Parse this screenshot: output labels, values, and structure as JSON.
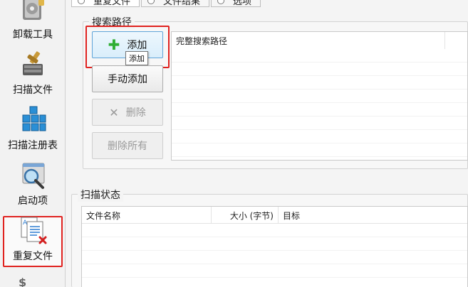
{
  "sidebar": {
    "items": [
      {
        "label": "卸载工具",
        "icon": "uninstall-icon"
      },
      {
        "label": "扫描文件",
        "icon": "scan-files-icon"
      },
      {
        "label": "扫描注册表",
        "icon": "registry-icon"
      },
      {
        "label": "启动项",
        "icon": "startup-icon"
      },
      {
        "label": "重复文件",
        "icon": "duplicate-files-icon",
        "active": true
      }
    ]
  },
  "tabs": [
    {
      "label": "重复文件",
      "active": true
    },
    {
      "label": "文件结果",
      "active": false
    },
    {
      "label": "选项",
      "active": false
    }
  ],
  "search_path": {
    "title": "搜索路径",
    "buttons": {
      "add": "添加",
      "manual_add": "手动添加",
      "delete": "删除",
      "delete_all": "删除所有"
    },
    "tooltip": "添加",
    "list_header": "完整搜索路径"
  },
  "scan_status": {
    "title": "扫描状态",
    "columns": [
      "文件名称",
      "大小 (字节)",
      "目标"
    ]
  },
  "colors": {
    "highlight": "#e0221f",
    "add_icon": "#2fae33"
  }
}
